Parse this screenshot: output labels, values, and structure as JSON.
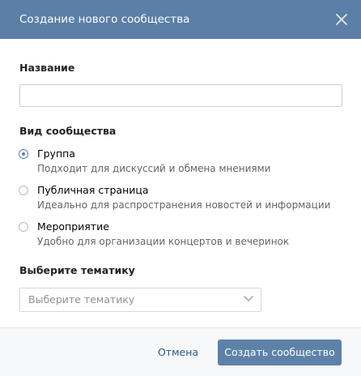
{
  "dialog": {
    "title": "Создание нового сообщества",
    "close_icon": "close-icon",
    "header_color": "#5b7fa6"
  },
  "name_field": {
    "label": "Название",
    "value": "",
    "placeholder": ""
  },
  "community_type": {
    "label": "Вид сообщества",
    "selected": "group",
    "options": [
      {
        "id": "group",
        "title": "Группа",
        "description": "Подходит для дискуссий и обмена мнениями",
        "checked": true
      },
      {
        "id": "public",
        "title": "Публичная страница",
        "description": "Идеально для распространения новостей и информации",
        "checked": false
      },
      {
        "id": "event",
        "title": "Мероприятие",
        "description": "Удобно для организации концертов и вечеринок",
        "checked": false
      }
    ]
  },
  "topic": {
    "label": "Выберите тематику",
    "selected_value": "Выберите тематику",
    "chevron_icon": "chevron-down-icon"
  },
  "footer": {
    "cancel_label": "Отмена",
    "submit_label": "Создать сообщество",
    "accent_color": "#5e81a8"
  }
}
